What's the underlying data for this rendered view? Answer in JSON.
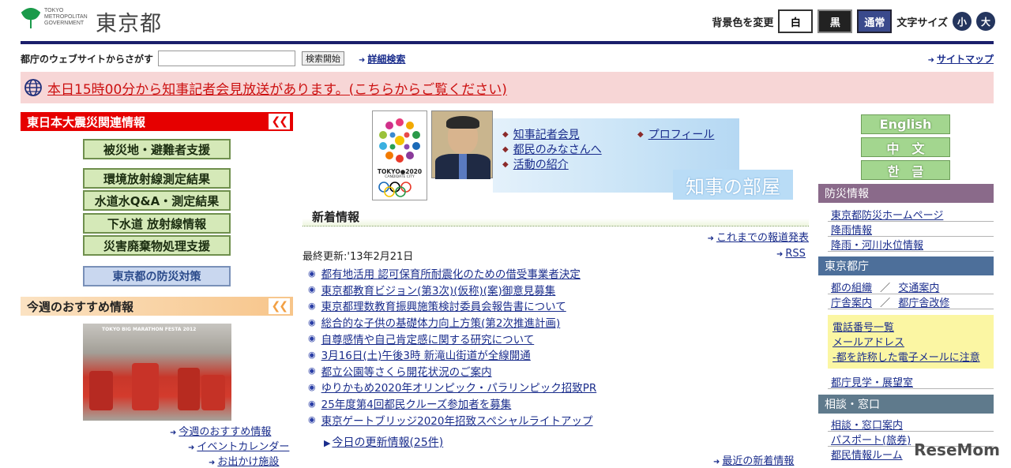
{
  "header": {
    "logo_small": [
      "TOKYO",
      "METROPOLITAN",
      "GOVERNMENT"
    ],
    "logo_big": "東京都",
    "bg_label": "背景色を変更",
    "bg_white": "白",
    "bg_black": "黒",
    "bg_normal": "通常",
    "font_label": "文字サイズ",
    "font_small": "小",
    "font_large": "大"
  },
  "search": {
    "label": "都庁のウェブサイトからさがす",
    "button": "検索開始",
    "advanced": "詳細検索",
    "sitemap": "サイトマップ",
    "value": ""
  },
  "alert": {
    "text": "本日15時00分から知事記者会見放送があります。(こちらからご覧ください)"
  },
  "quake": {
    "title": "東日本大震災関連情報",
    "buttons": [
      "被災地・避難者支援",
      "環境放射線測定結果",
      "水道水Q&A・測定結果",
      "下水道 放射線情報",
      "災害廃棄物処理支援"
    ],
    "disaster_button": "東京都の防災対策"
  },
  "recommend": {
    "title": "今週のおすすめ情報",
    "photo_caption": "TOKYO BIG MARATHON FESTA 2012",
    "links": [
      "今週のおすすめ情報",
      "イベントカレンダー",
      "お出かけ施設"
    ]
  },
  "governor": {
    "emblem_text": "TOKYO●2020",
    "emblem_sub": "CANDIDATE CITY",
    "links": [
      "知事記者会見",
      "都民のみなさんへ",
      "活動の紹介"
    ],
    "profile": "プロフィール",
    "room_title": "知事の部屋"
  },
  "news": {
    "title": "新着情報",
    "past_link": "これまでの報道発表",
    "updated": "最終更新:'13年2月21日",
    "rss": "RSS",
    "items": [
      "都有地活用 認可保育所耐震化のための借受事業者決定",
      "東京都教育ビジョン(第3次)(仮称)(案)御意見募集",
      "東京都理数教育振興施策検討委員会報告書について",
      "総合的な子供の基礎体力向上方策(第2次推進計画)",
      "自尊感情や自己肯定感に関する研究について",
      "3月16日(土)午後3時 新滝山街道が全線開通",
      "都立公園等さくら開花状況のご案内",
      "ゆりかもめ2020年オリンピック・パラリンピック招致PR",
      "25年度第4回都民クルーズ参加者を募集",
      "東京ゲートブリッジ2020年招致スペシャルライトアップ"
    ],
    "today": "今日の更新情報(25件)",
    "latest": "最近の新着情報"
  },
  "languages": [
    "English",
    "中　文",
    "한　글"
  ],
  "bousai": {
    "title": "防災情報",
    "links": [
      "東京都防災ホームページ",
      "降雨情報",
      "降雨・河川水位情報"
    ]
  },
  "tocho": {
    "title": "東京都庁",
    "row1": [
      "都の組織",
      "交通案内"
    ],
    "row2": [
      "庁舎案内",
      "都庁舎改修"
    ],
    "sep": "／",
    "yellow": [
      "電話番号一覧",
      "メールアドレス",
      "-都を詐称した電子メールに注意"
    ],
    "tour": "都庁見学・展望室"
  },
  "soudan": {
    "title": "相談・窓口",
    "links": [
      "相談・窓口案内",
      "パスポート(旅券)",
      "都民情報ルーム"
    ]
  },
  "watermark": "ReseMom",
  "colors": {
    "accent_red": "#e60000",
    "navy": "#1b1f6b",
    "bousai_head": "#8a6a8a",
    "tocho_head": "#4d6f9a",
    "soudan_head": "#5f7a8c"
  }
}
